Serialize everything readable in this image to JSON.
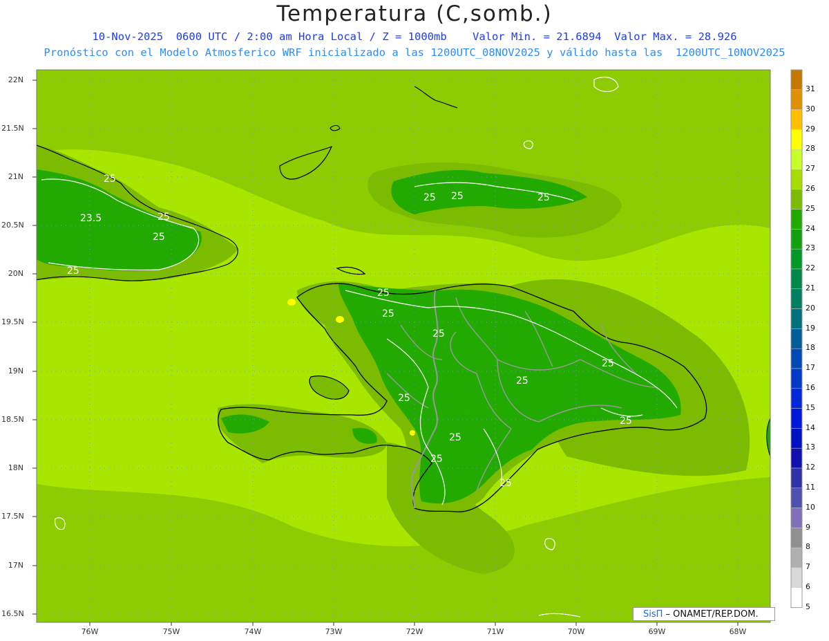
{
  "header": {
    "title": "Temperatura (C,somb.)",
    "line1": "10-Nov-2025  0600 UTC / 2:00 am Hora Local / Z = 1000mb    Valor Min. = 21.6894  Valor Max. = 28.926",
    "line2": "Pronóstico con el Modelo Atmosferico WRF inicializado a las 1200UTC_08NOV2025 y válido hasta las  1200UTC_10NOV2025"
  },
  "axes": {
    "lat_ticks": [
      "22N",
      "21.5N",
      "21N",
      "20.5N",
      "20N",
      "19.5N",
      "19N",
      "18.5N",
      "18N",
      "17.5N",
      "17N",
      "16.5N"
    ],
    "lon_ticks": [
      "76W",
      "75W",
      "74W",
      "73W",
      "72W",
      "71W",
      "70W",
      "69W",
      "68W"
    ]
  },
  "contour_labels": [
    "25",
    "25",
    "23.5",
    "25",
    "25",
    "25",
    "25",
    "25",
    "25",
    "25",
    "25",
    "25",
    "25",
    "25",
    "25",
    "25",
    "25",
    "25",
    "25",
    "25"
  ],
  "colorbar": {
    "levels": [
      "31",
      "30",
      "29",
      "28",
      "27",
      "26",
      "25",
      "24",
      "23",
      "22",
      "21",
      "20",
      "19",
      "18",
      "17",
      "16",
      "15",
      "14",
      "13",
      "12",
      "11",
      "10",
      "9",
      "8",
      "7",
      "6",
      "5"
    ],
    "colors": [
      "#c47a00",
      "#e09000",
      "#ffc000",
      "#ffff00",
      "#c8ff28",
      "#a8dc00",
      "#7cbc00",
      "#22aa00",
      "#10a010",
      "#009828",
      "#008848",
      "#008060",
      "#00707a",
      "#005c96",
      "#0048b4",
      "#0038c8",
      "#0028d8",
      "#0018d8",
      "#0010c4",
      "#1010b0",
      "#3030a8",
      "#5050b0",
      "#8070b8",
      "#909090",
      "#b0b0b0",
      "#d8d8d8",
      "#ffffff"
    ]
  },
  "credit": {
    "brand": "SisΠ",
    "text": " – ONAMET/REP.DOM."
  },
  "colors": {
    "sea": "#a8e600",
    "land": "#22aa00",
    "mid": "#7cbc00",
    "border": "#999999",
    "coast": "#000000",
    "title_blue": "#1a3cff",
    "subtitle_blue": "#2a8cff"
  }
}
